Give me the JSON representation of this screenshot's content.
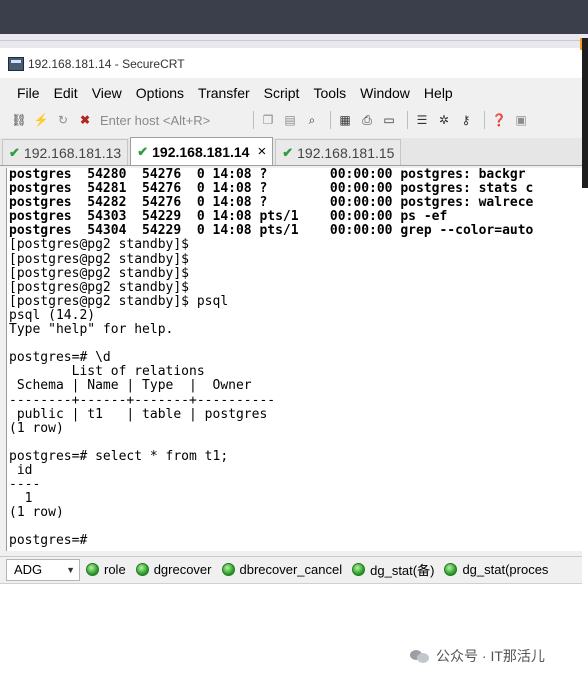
{
  "window": {
    "title": "192.168.181.14 - SecureCRT"
  },
  "menu": [
    "File",
    "Edit",
    "View",
    "Options",
    "Transfer",
    "Script",
    "Tools",
    "Window",
    "Help"
  ],
  "toolbar": {
    "host_placeholder": "Enter host <Alt+R>",
    "icons": [
      "connect-icon",
      "quick-connect-icon",
      "reconnect-icon",
      "disconnect-icon",
      "copy-icon",
      "paste-icon",
      "find-icon",
      "print-setup-icon",
      "print-icon",
      "print-screen-icon",
      "session-options-icon",
      "global-options-icon",
      "key-icon",
      "help-icon",
      "screen-icon"
    ]
  },
  "tabs": [
    {
      "label": "192.168.181.13",
      "active": false
    },
    {
      "label": "192.168.181.14",
      "active": true,
      "close": "×"
    },
    {
      "label": "192.168.181.15",
      "active": false
    }
  ],
  "terminal": {
    "lines": [
      {
        "text": "postgres  54280  54276  0 14:08 ?        00:00:00 postgres: backgr",
        "bold": true
      },
      {
        "text": "postgres  54281  54276  0 14:08 ?        00:00:00 postgres: stats c",
        "bold": true
      },
      {
        "text": "postgres  54282  54276  0 14:08 ?        00:00:00 postgres: walrece",
        "bold": true
      },
      {
        "text": "postgres  54303  54229  0 14:08 pts/1    00:00:00 ps -ef",
        "bold": true
      },
      {
        "text": "postgres  54304  54229  0 14:08 pts/1    00:00:00 grep --color=auto",
        "bold": true
      },
      {
        "text": "[postgres@pg2 standby]$"
      },
      {
        "text": "[postgres@pg2 standby]$"
      },
      {
        "text": "[postgres@pg2 standby]$"
      },
      {
        "text": "[postgres@pg2 standby]$"
      },
      {
        "text": "[postgres@pg2 standby]$ psql"
      },
      {
        "text": "psql (14.2)"
      },
      {
        "text": "Type \"help\" for help."
      },
      {
        "text": ""
      },
      {
        "text": "postgres=# \\d"
      },
      {
        "text": "        List of relations"
      },
      {
        "text": " Schema | Name | Type  |  Owner"
      },
      {
        "text": "--------+------+-------+----------"
      },
      {
        "text": " public | t1   | table | postgres"
      },
      {
        "text": "(1 row)"
      },
      {
        "text": ""
      },
      {
        "text": "postgres=# select * from t1;"
      },
      {
        "text": " id"
      },
      {
        "text": "----"
      },
      {
        "text": "  1"
      },
      {
        "text": "(1 row)"
      },
      {
        "text": ""
      },
      {
        "text": "postgres=#"
      }
    ]
  },
  "button_bar": {
    "selected": "ADG",
    "buttons": [
      "role",
      "dgrecover",
      "dbrecover_cancel",
      "dg_stat(备)",
      "dg_stat(proces"
    ]
  },
  "watermark": {
    "text": "公众号 · IT那活儿"
  }
}
